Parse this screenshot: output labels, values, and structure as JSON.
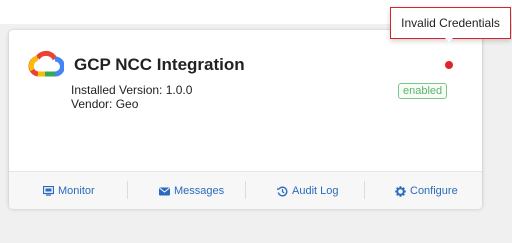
{
  "integration": {
    "title": "GCP NCC Integration",
    "installed_version": "Installed Version: 1.0.0",
    "vendor": "Vendor: Geo",
    "status_badge": "enabled",
    "status_color": "#e0242b"
  },
  "tooltip": {
    "text": "Invalid Credentials"
  },
  "actions": [
    {
      "label": "Monitor",
      "icon": "monitor-icon"
    },
    {
      "label": "Messages",
      "icon": "envelope-icon"
    },
    {
      "label": "Audit Log",
      "icon": "history-icon"
    },
    {
      "label": "Configure",
      "icon": "gear-icon"
    }
  ],
  "colors": {
    "link": "#2b6bbf",
    "badge": "#5bb56d",
    "error": "#d8232a"
  }
}
